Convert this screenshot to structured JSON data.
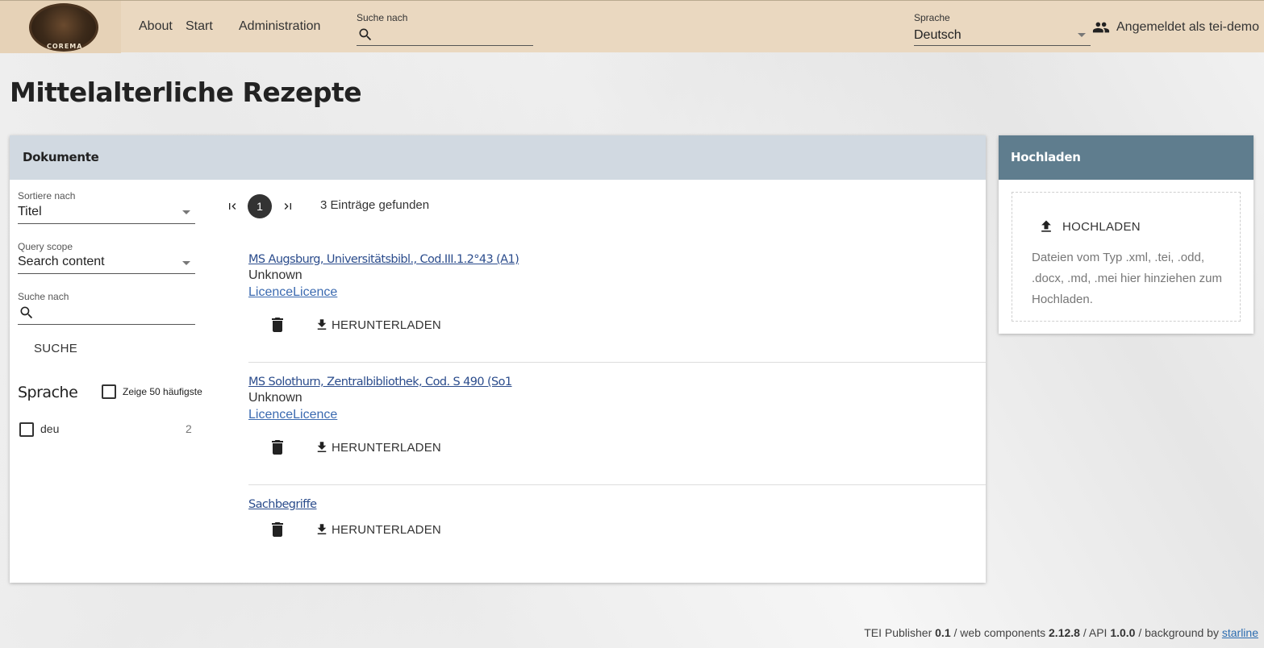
{
  "header": {
    "logo_text": "COREMA",
    "nav": [
      {
        "label": "About"
      },
      {
        "label": "Start"
      },
      {
        "label": "Administration"
      }
    ],
    "search": {
      "label": "Suche nach",
      "value": ""
    },
    "language": {
      "label": "Sprache",
      "value": "Deutsch"
    },
    "user_label": "Angemeldet als tei-demo"
  },
  "page_title": "Mittelalterliche Rezepte",
  "documents": {
    "heading": "Dokumente",
    "sort": {
      "label": "Sortiere nach",
      "value": "Titel"
    },
    "scope": {
      "label": "Query scope",
      "value": "Search content"
    },
    "search": {
      "label": "Suche nach",
      "value": ""
    },
    "search_button": "SUCHE",
    "facet": {
      "title": "Sprache",
      "show_top_label": "Zeige 50 häufigste",
      "items": [
        {
          "label": "deu",
          "count": "2"
        }
      ]
    },
    "pager": {
      "current_page": "1"
    },
    "found_text": "3 Einträge gefunden",
    "items": [
      {
        "title": "MS Augsburg, Universitätsbibl., Cod.III.1.2°43 (A1)",
        "author": "Unknown",
        "licence": "LicenceLicence",
        "download_label": "HERUNTERLADEN"
      },
      {
        "title": "MS Solothurn, Zentralbibliothek, Cod. S 490 (So1",
        "author": "Unknown",
        "licence": "LicenceLicence",
        "download_label": "HERUNTERLADEN"
      },
      {
        "title": "Sachbegriffe",
        "download_label": "HERUNTERLADEN"
      }
    ]
  },
  "upload": {
    "heading": "Hochladen",
    "button_label": "HOCHLADEN",
    "hint": "Dateien vom Typ .xml, .tei, .odd, .docx, .md, .mei hier hinziehen zum Hochladen."
  },
  "footer": {
    "p1": "TEI Publisher ",
    "v1": "0.1",
    "p2": " / web components ",
    "v2": "2.12.8",
    "p3": " / API ",
    "v3": "1.0.0",
    "p4": " / background by ",
    "link": "starline"
  }
}
